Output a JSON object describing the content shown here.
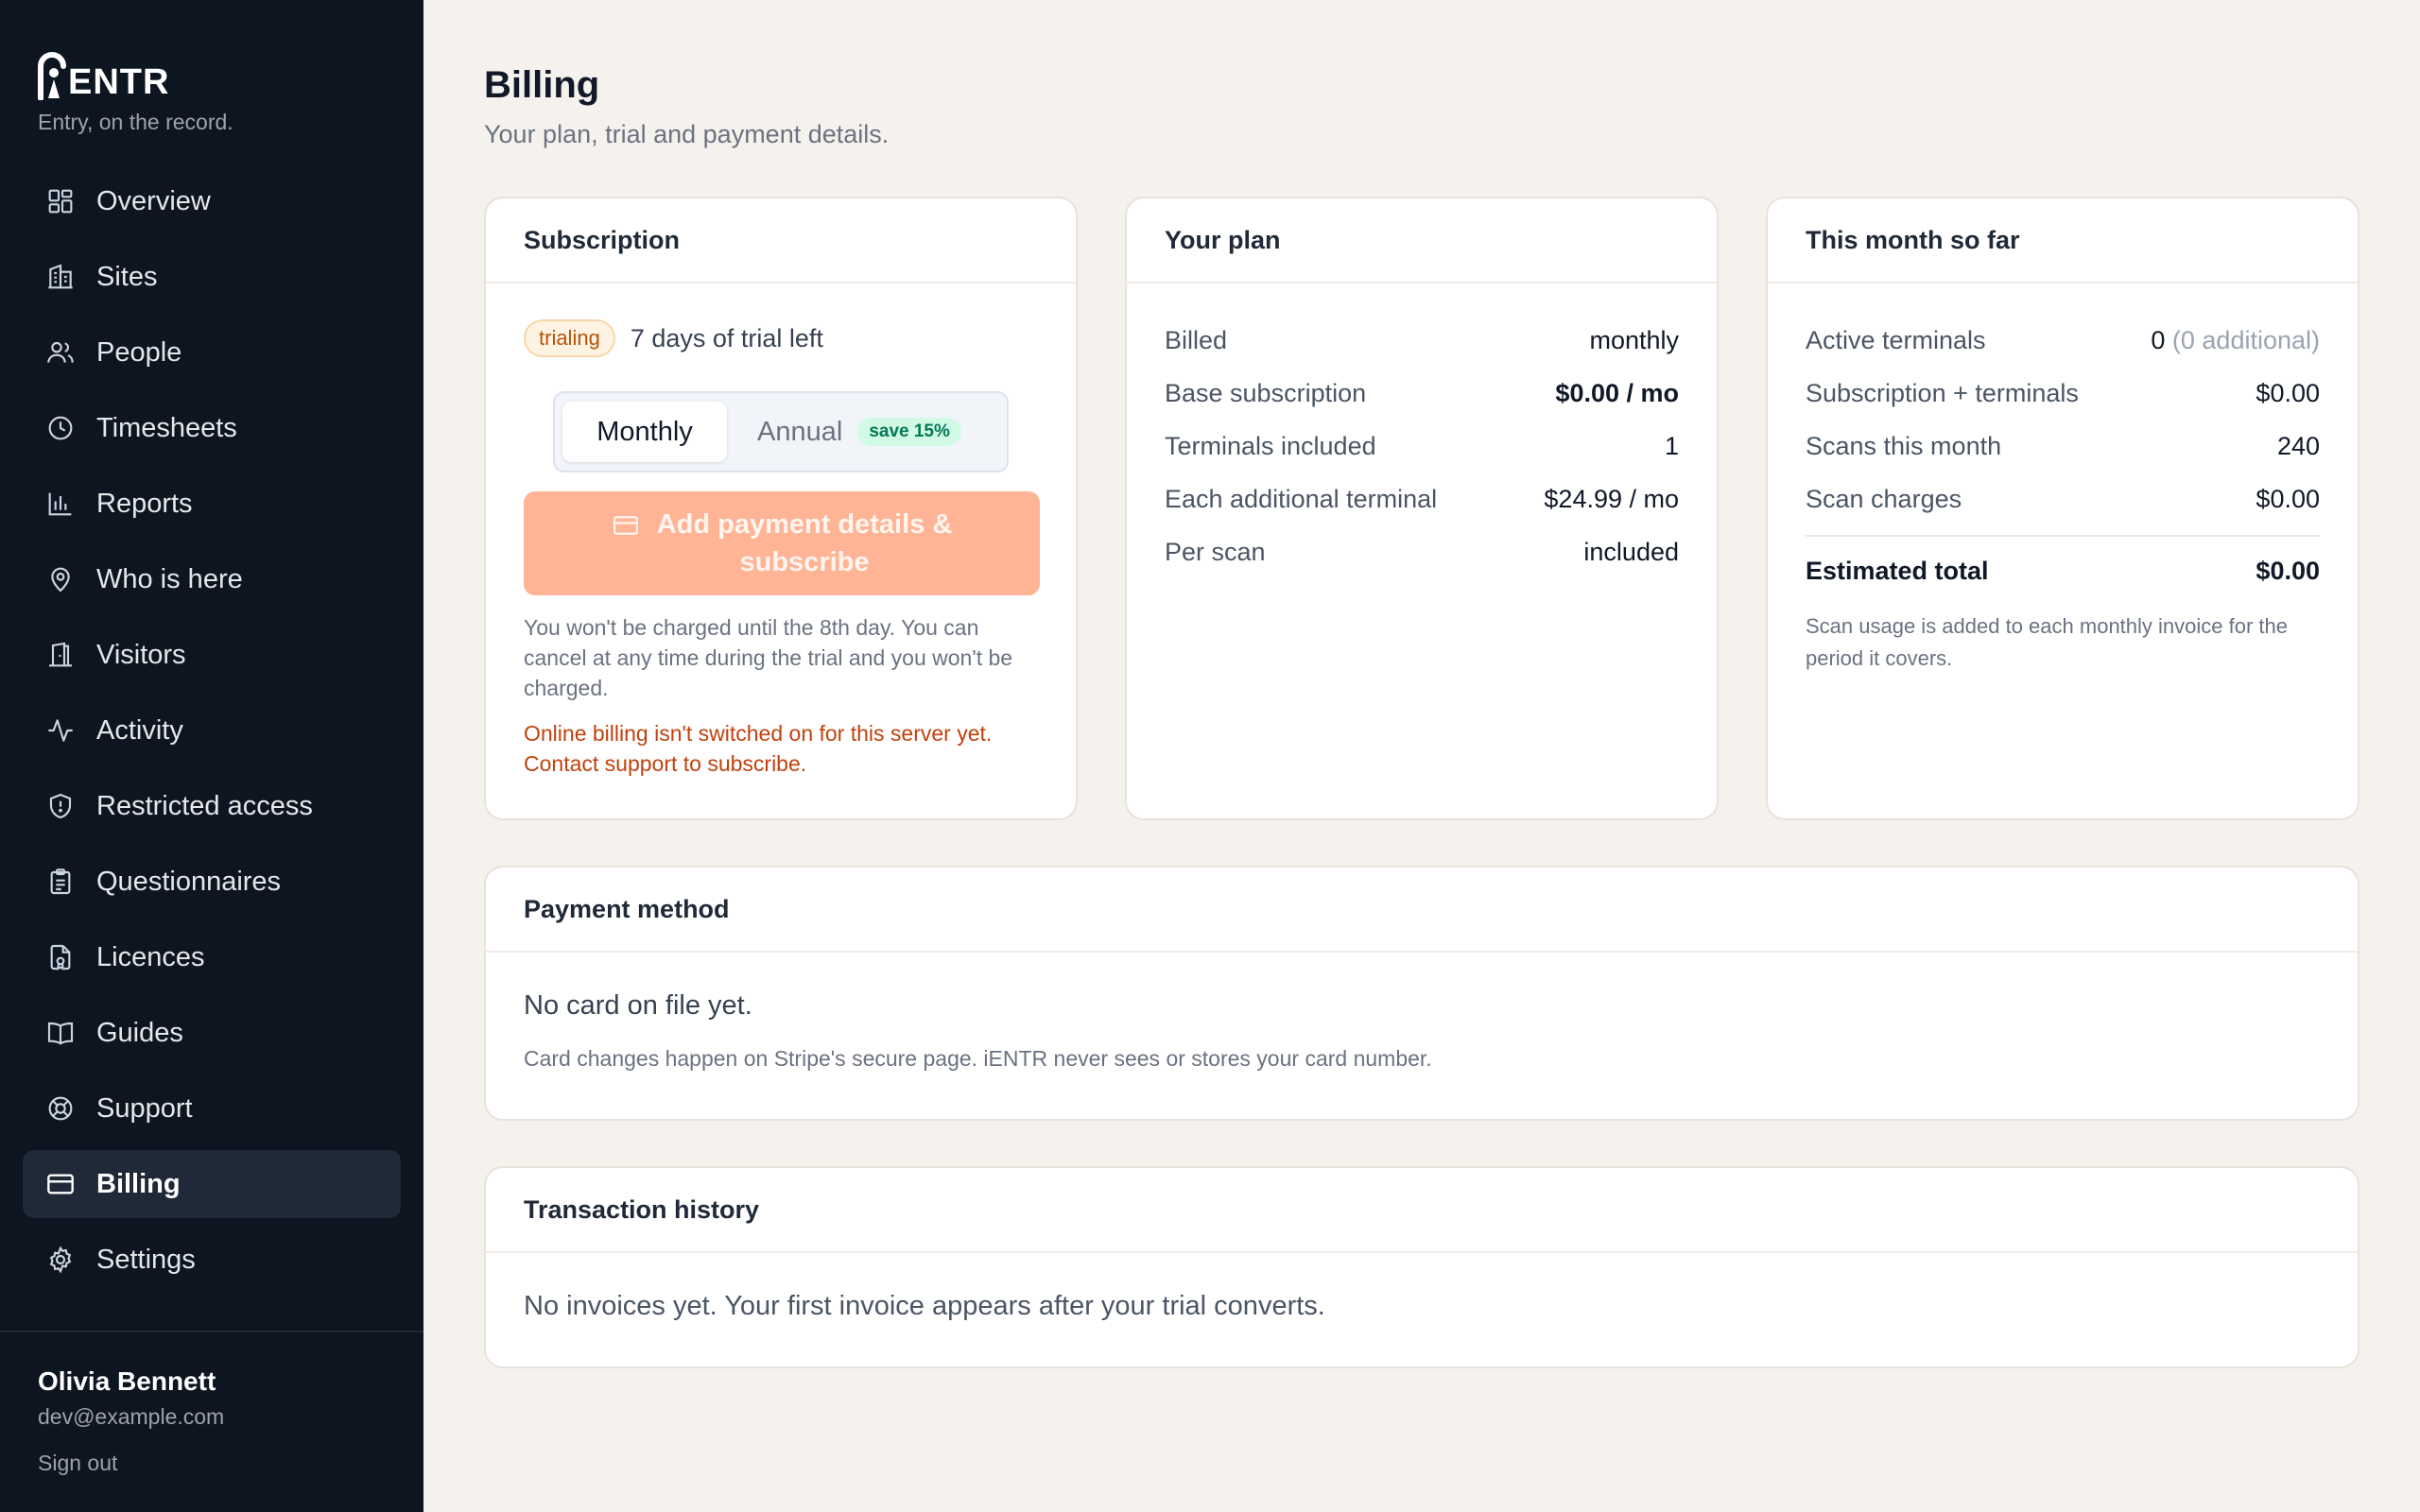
{
  "brand": {
    "name": "ENTR",
    "tagline": "Entry, on the record."
  },
  "nav": {
    "items": [
      {
        "label": "Overview",
        "icon": "grid-icon"
      },
      {
        "label": "Sites",
        "icon": "building-icon"
      },
      {
        "label": "People",
        "icon": "people-icon"
      },
      {
        "label": "Timesheets",
        "icon": "clock-icon"
      },
      {
        "label": "Reports",
        "icon": "bar-chart-icon"
      },
      {
        "label": "Who is here",
        "icon": "location-pin-icon"
      },
      {
        "label": "Visitors",
        "icon": "door-icon"
      },
      {
        "label": "Activity",
        "icon": "pulse-icon"
      },
      {
        "label": "Restricted access",
        "icon": "shield-icon"
      },
      {
        "label": "Questionnaires",
        "icon": "clipboard-icon"
      },
      {
        "label": "Licences",
        "icon": "document-icon"
      },
      {
        "label": "Guides",
        "icon": "book-icon"
      },
      {
        "label": "Support",
        "icon": "lifebuoy-icon"
      },
      {
        "label": "Billing",
        "icon": "credit-card-icon",
        "active": true
      },
      {
        "label": "Settings",
        "icon": "gear-icon"
      }
    ]
  },
  "user": {
    "name": "Olivia Bennett",
    "email": "dev@example.com",
    "signout": "Sign out"
  },
  "page": {
    "title": "Billing",
    "subtitle": "Your plan, trial and payment details."
  },
  "subscription": {
    "title": "Subscription",
    "status_badge": "trialing",
    "trial_text": "7 days of trial left",
    "toggle_monthly": "Monthly",
    "toggle_annual": "Annual",
    "save_badge": "save 15%",
    "button_line1": "Add payment details &",
    "button_line2": "subscribe",
    "note": "You won't be charged until the 8th day. You can cancel at any time during the trial and you won't be charged.",
    "warning": "Online billing isn't switched on for this server yet. Contact support to subscribe."
  },
  "plan": {
    "title": "Your plan",
    "rows": [
      {
        "label": "Billed",
        "value": "monthly"
      },
      {
        "label": "Base subscription",
        "value": "$0.00 / mo"
      },
      {
        "label": "Terminals included",
        "value": "1"
      },
      {
        "label": "Each additional terminal",
        "value": "$24.99 / mo"
      },
      {
        "label": "Per scan",
        "value": "included"
      }
    ]
  },
  "month": {
    "title": "This month so far",
    "active_label": "Active terminals",
    "active_value": "0",
    "active_extra": "(0 additional)",
    "rows": [
      {
        "label": "Subscription + terminals",
        "value": "$0.00"
      },
      {
        "label": "Scans this month",
        "value": "240"
      },
      {
        "label": "Scan charges",
        "value": "$0.00"
      }
    ],
    "total_label": "Estimated total",
    "total_value": "$0.00",
    "note": "Scan usage is added to each monthly invoice for the period it covers."
  },
  "payment": {
    "title": "Payment method",
    "empty": "No card on file yet.",
    "note": "Card changes happen on Stripe's secure page. iENTR never sees or stores your card number."
  },
  "transactions": {
    "title": "Transaction history",
    "empty": "No invoices yet. Your first invoice appears after your trial converts."
  },
  "colors": {
    "sidebar": "#0d1520",
    "accent": "#ffb496",
    "warning": "#c2410c",
    "background": "#f5f2ee"
  }
}
